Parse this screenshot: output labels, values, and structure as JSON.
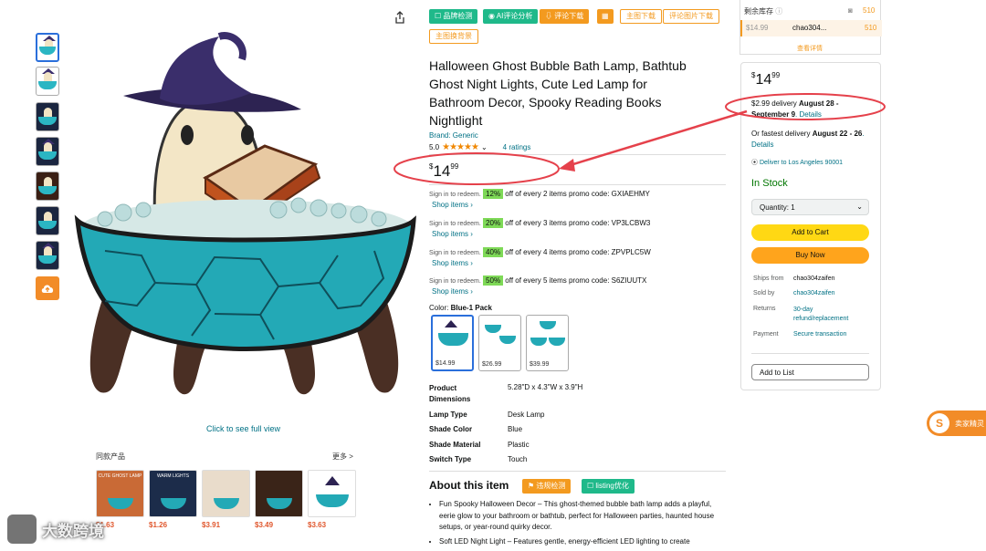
{
  "thumbnails": [
    "thumb-1",
    "thumb-2",
    "thumb-3",
    "thumb-4",
    "thumb-5",
    "thumb-6",
    "thumb-7"
  ],
  "icons": {
    "upload": "cloud-upload-icon",
    "share": "share-icon"
  },
  "see_full_view": "Click to see full view",
  "similar": {
    "title": "同款产品",
    "more": "更多 >",
    "cards": [
      {
        "banner": "CUTE GHOST LAMP",
        "price": "$1.63"
      },
      {
        "banner": "WARM LIGHTS",
        "price": "$1.26"
      },
      {
        "banner": "",
        "price": "$3.91"
      },
      {
        "banner": "",
        "price": "$3.49"
      },
      {
        "banner": "",
        "price": "$3.63"
      }
    ]
  },
  "plugin": {
    "brand_check": "品牌检测",
    "ai_review": "AI评论分析",
    "review_download": "评论下载",
    "calc": "▦",
    "main_image_download": "主图下载",
    "review_image_download": "评论图片下载",
    "main_image_bg": "主图换背景"
  },
  "product": {
    "title": "Halloween Ghost Bubble Bath Lamp, Bathtub Ghost Night Lights, Cute Led Lamp for Bathroom Decor, Spooky Reading Books Nightlight",
    "brand": "Brand: Generic",
    "rating": "5.0",
    "stars": "★★★★★",
    "ratings_count": "4 ratings",
    "price_symbol": "$",
    "price_whole": "14",
    "price_fraction": "99"
  },
  "promos": [
    {
      "sign": "Sign in to redeem.",
      "pct": "12%",
      "text": "off of every 2 items promo code: GXIAEHMY",
      "shop": "Shop items ›"
    },
    {
      "sign": "Sign in to redeem.",
      "pct": "20%",
      "text": "off of every 3 items promo code: VP3LCBW3",
      "shop": "Shop items ›"
    },
    {
      "sign": "Sign in to redeem.",
      "pct": "40%",
      "text": "off of every 4 items promo code: ZPVPLC5W",
      "shop": "Shop items ›"
    },
    {
      "sign": "Sign in to redeem.",
      "pct": "50%",
      "text": "off of every 5 items promo code: S6ZIUUTX",
      "shop": "Shop items ›"
    }
  ],
  "color": {
    "label": "Color: ",
    "value": "Blue-1 Pack"
  },
  "swatches": [
    {
      "price": "$14.99"
    },
    {
      "price": "$26.99"
    },
    {
      "price": "$39.99"
    }
  ],
  "specs": [
    {
      "k": "Product Dimensions",
      "v": "5.28\"D x 4.3\"W x 3.9\"H"
    },
    {
      "k": "Lamp Type",
      "v": "Desk Lamp"
    },
    {
      "k": "Shade Color",
      "v": "Blue"
    },
    {
      "k": "Shade Material",
      "v": "Plastic"
    },
    {
      "k": "Switch Type",
      "v": "Touch"
    }
  ],
  "about": {
    "title": "About this item",
    "violation_check": "违规检测",
    "listing_optimize": "listing优化",
    "bullets": [
      "Fun Spooky Halloween Decor – This ghost-themed bubble bath lamp adds a playful, eerie glow to your bathroom or bathtub, perfect for Halloween parties, haunted house setups, or year-round quirky decor.",
      "Soft LED Night Light – Features gentle, energy-efficient LED lighting to create"
    ]
  },
  "stock": {
    "label": "剩余库存",
    "total": "510",
    "row_price": "$14.99",
    "row_seller": "chao304...",
    "row_qty": "510",
    "details": "查看详情"
  },
  "buybox": {
    "price_symbol": "$",
    "price_whole": "14",
    "price_fraction": "99",
    "delivery_pre": "$2.99 delivery ",
    "delivery_date": "August 28 - September 9",
    "delivery_details": ". Details",
    "fastest_pre": "Or fastest delivery ",
    "fastest_date": "August 22 - 26",
    "fastest_details": ". Details",
    "deliver_to": "Deliver to Los Angeles 90001",
    "in_stock": "In Stock",
    "quantity": "Quantity: 1",
    "add_to_cart": "Add to Cart",
    "buy_now": "Buy Now",
    "ships_from_k": "Ships from",
    "ships_from_v": "chao304zaifen",
    "sold_by_k": "Sold by",
    "sold_by_v": "chao304zaifen",
    "returns_k": "Returns",
    "returns_v": "30-day refund/replacement",
    "payment_k": "Payment",
    "payment_v": "Secure transaction",
    "add_to_list": "Add to List"
  },
  "float_badge": {
    "icon": "S",
    "label": "卖家精灵"
  },
  "watermark": "大数跨境",
  "colors": {
    "annotation": "#e5414b",
    "price_pct": "#7ed957",
    "accent": "#f28c28"
  }
}
